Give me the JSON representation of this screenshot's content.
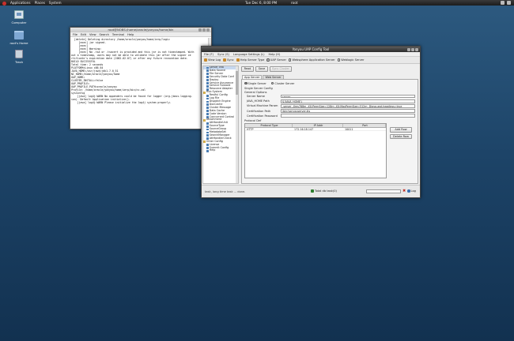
{
  "top_panel": {
    "menu": [
      "Applications",
      "Places",
      "System"
    ],
    "clock": "Tue Dec  6,  8:00 PM",
    "user": "root"
  },
  "desktop": {
    "icons": [
      {
        "label": "Computer",
        "icon": "computer-icon"
      },
      {
        "label": "root's Home",
        "icon": "folder-icon"
      },
      {
        "label": "Trash",
        "icon": "trash-icon"
      }
    ]
  },
  "terminal": {
    "title": "root@NOBS:/home/oracle/yonyou/home/bin",
    "menu": [
      "File",
      "Edit",
      "View",
      "Search",
      "Terminal",
      "Help"
    ],
    "lines": [
      "  [delete] Deleting directory /home/oracle/yonyou/home/ierp/logic",
      "     [exec] jar signed.",
      "     [exec]",
      "     [exec] Warning:",
      "     [exec] No -tsa or -tsacert is provided and this jar is not timestamped. With",
      "out a timestamp, users may not be able to validate this jar after the signer ce",
      "rtificate's expiration date (2062-02-07) or after any future revocation date.",
      "",
      "BUILD SUCCESSFUL",
      "Total time: 2 seconds",
      "PLATFORM=Linux x86_64",
      "JAVA_HOME=/usr/java/jdk1.7.0_51",
      "NC_HOME=/home/oracle/yonyou/home",
      "UAP_HOME=",
      "CLUSTER_INSTALL=false",
      "UAP_PROFILE=",
      "UAP_PROFILE_PATH=oracle/yonyou",
      "Profile: /home/oracle/yonyou/home/ierp/bin/nc.xml",
      "",
      "sysConfig",
      "    [java] log4j:WARN No appenders could be found for logger (org.jboss.logging.",
      "ion). Default Application initialize().",
      "    [java] log4j:WARN Please initialize the log4j system properly."
    ]
  },
  "config": {
    "title": "Yonyou UAP Config Tool",
    "menu": [
      "File (F)",
      "Sync (S)",
      "Language Settings (L)",
      "Help (H)"
    ],
    "toolbar": {
      "view_log": "View Log",
      "sync": "Sync",
      "help_server_type": "Help Server Type",
      "options": [
        "UAP Server",
        "Websphere Application Server",
        "Weblogic Server"
      ],
      "selected": 0
    },
    "tree": [
      {
        "label": "Server Info",
        "type": "child",
        "selected": true
      },
      {
        "label": "Data Source",
        "type": "child"
      },
      {
        "label": "File Server",
        "type": "child"
      },
      {
        "label": "Security Data Conf",
        "type": "child"
      },
      {
        "label": "Deploy",
        "type": "child"
      },
      {
        "label": "Service Assurance",
        "type": "child"
      },
      {
        "label": "Service Forward",
        "type": "child"
      },
      {
        "label": "Resource Adapter",
        "type": "child"
      },
      {
        "label": "Hub System",
        "type": "folder"
      },
      {
        "label": "Restful Config",
        "type": "child"
      },
      {
        "label": "Log File",
        "type": "child"
      },
      {
        "label": "Dispatch Engine",
        "type": "child"
      },
      {
        "label": "DocCache",
        "type": "child"
      },
      {
        "label": "Cluster Message",
        "type": "child"
      },
      {
        "label": "Data Cache",
        "type": "child"
      },
      {
        "label": "Code Version",
        "type": "child"
      },
      {
        "label": "Concurrent Control",
        "type": "child"
      },
      {
        "label": "Attachment",
        "type": "folder"
      },
      {
        "label": "AttHandleUnit",
        "type": "child"
      },
      {
        "label": "SourceType",
        "type": "child"
      },
      {
        "label": "SourceGroup",
        "type": "child"
      },
      {
        "label": "MetadataSet",
        "type": "child"
      },
      {
        "label": "SearchManager",
        "type": "child"
      },
      {
        "label": "AttHandlerCheck",
        "type": "child"
      },
      {
        "label": "Other Config",
        "type": "folder"
      },
      {
        "label": "License",
        "type": "child"
      },
      {
        "label": "Summit Config",
        "type": "child"
      },
      {
        "label": "Help",
        "type": "child"
      }
    ],
    "actions": {
      "read": "Read",
      "save": "Save",
      "sync_cluster": "Sync Cluster"
    },
    "tabs": [
      "App Server",
      "Web Server"
    ],
    "active_tab": 0,
    "mode": {
      "single": "Single Server",
      "cluster": "Cluster Server",
      "selected": "single"
    },
    "section_single": "Single Server Config",
    "section_general": "General Options",
    "fields": [
      {
        "label": "Server Name",
        "value": "server"
      },
      {
        "label": "JAVA_HOME Path",
        "value": "${JAVA_HOME}"
      },
      {
        "label": "Virtual Machine Param",
        "value": "-server -Xms768m -XX:PermSize=128m -XX:MaxPermSize=512m -Djava.awt.headless=true"
      },
      {
        "label": "Certification Path",
        "value": "/bin/yonyouserver.jks"
      },
      {
        "label": "Certification Password",
        "value": ""
      }
    ],
    "protocol_section": "Protocol Def",
    "protocol_table": {
      "headers": [
        "Protocol Type",
        "IP Addr",
        "Port"
      ],
      "rows": [
        [
          "HTTP",
          "172.16.18.147",
          "10011"
        ]
      ]
    },
    "add_row": "Add Row",
    "delete_row": "Delete Row",
    "status": {
      "message": "task, long time task ... done.",
      "total_label": "Total db task(0)",
      "progress": 0,
      "log": "Log"
    }
  }
}
